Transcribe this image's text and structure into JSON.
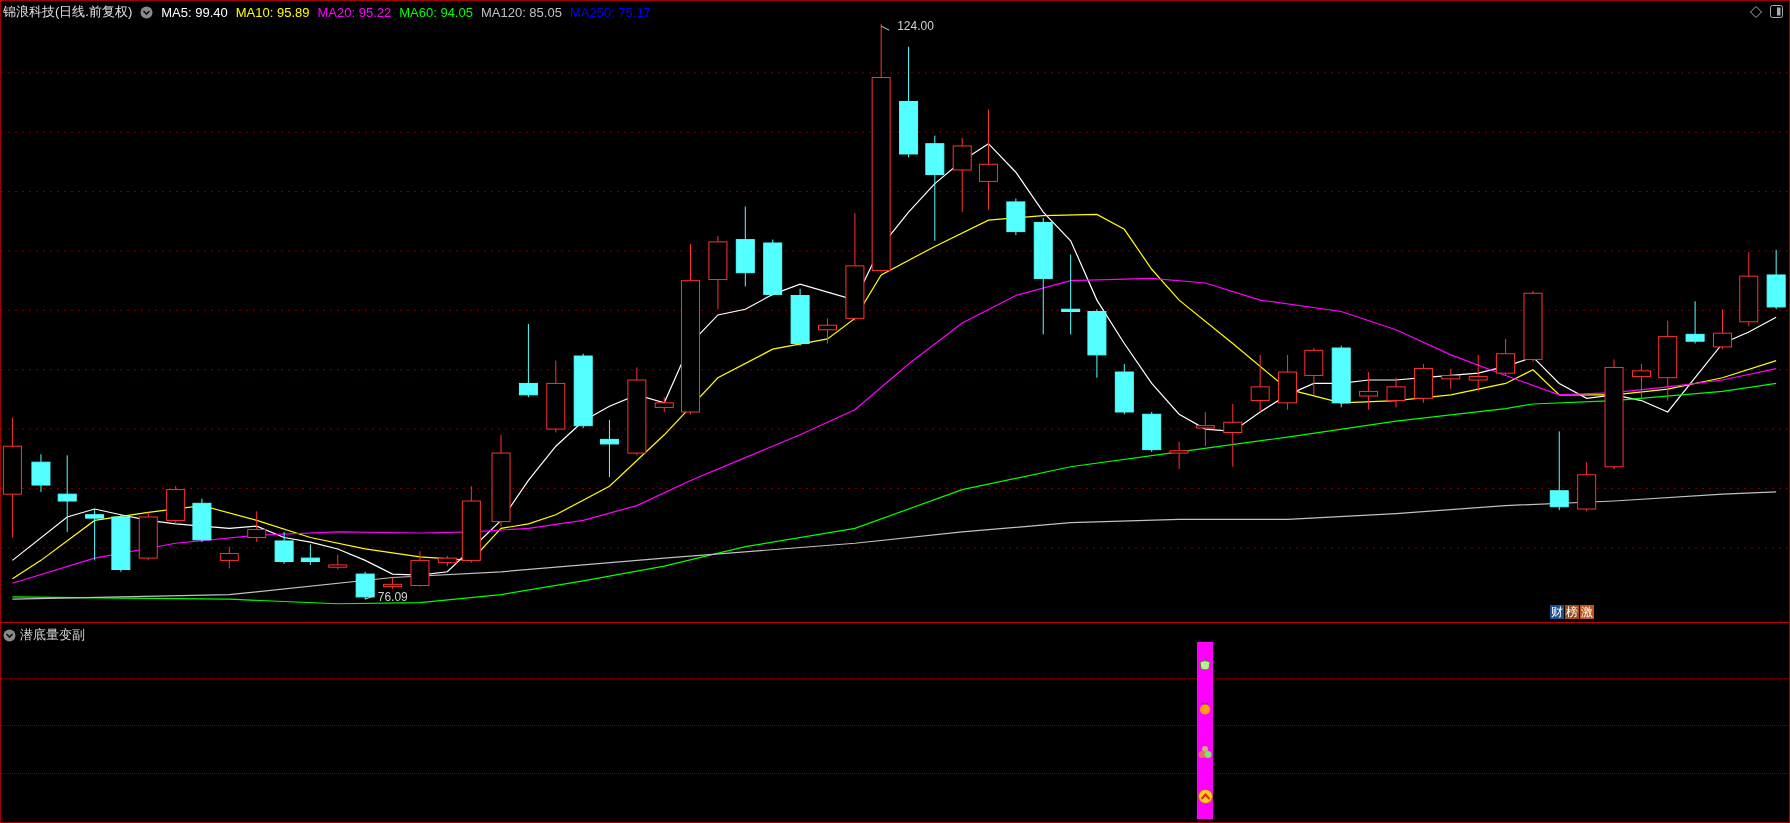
{
  "title": {
    "stock": "锦浪科技(日线.前复权)"
  },
  "moving_averages": [
    {
      "label": "MA5: 99.40",
      "color": "#ffffff"
    },
    {
      "label": "MA10: 95.89",
      "color": "#ffff00"
    },
    {
      "label": "MA20: 95.22",
      "color": "#ff00ff"
    },
    {
      "label": "MA60: 94.05",
      "color": "#00ff00"
    },
    {
      "label": "MA120: 85.05",
      "color": "#c0c0c0"
    },
    {
      "label": "MA250: 75.17",
      "color": "#0000ff"
    }
  ],
  "chart": {
    "high_label": "124.00",
    "low_label": "76.09",
    "badges": [
      {
        "text": "财",
        "color": "#1b4f8f"
      },
      {
        "text": "榜",
        "color": "#9a4f1c"
      },
      {
        "text": "激",
        "color": "#c0561b"
      }
    ]
  },
  "indicator": {
    "title": "潜底量变副"
  }
}
